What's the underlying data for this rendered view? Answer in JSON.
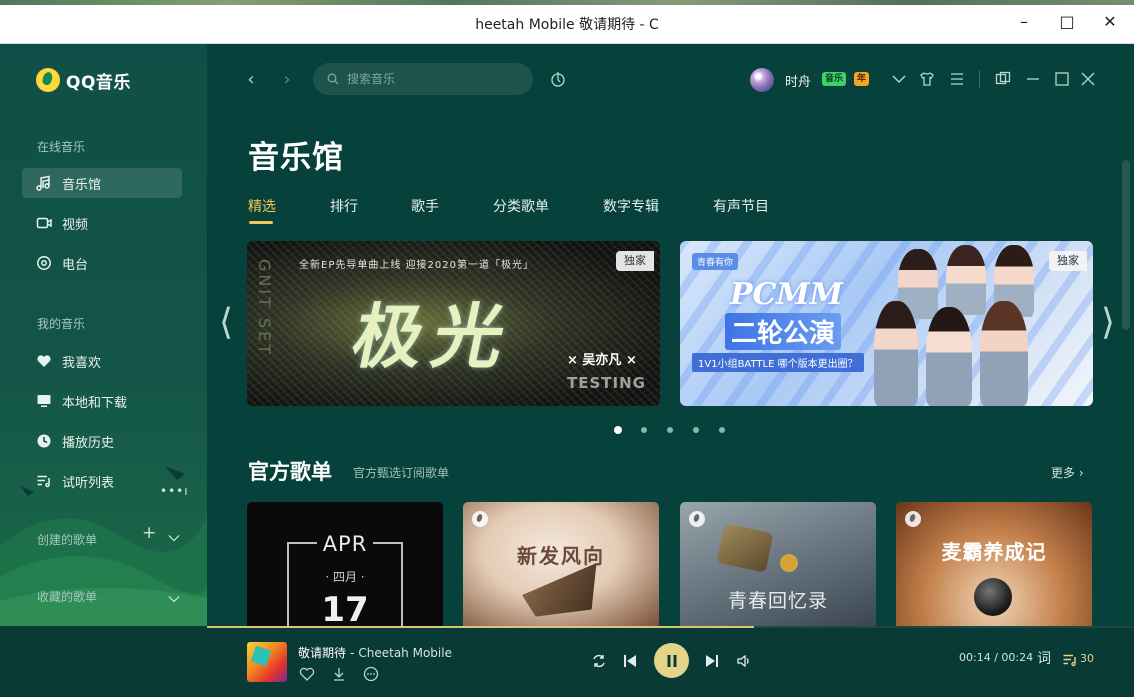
{
  "window": {
    "title": "heetah Mobile 敬请期待 - C",
    "controls": [
      "minimize",
      "maximize",
      "close"
    ]
  },
  "sidebar": {
    "app_name": "QQ音乐",
    "online_label": "在线音乐",
    "online_items": [
      {
        "label": "音乐馆",
        "icon": "music-note-icon",
        "active": true
      },
      {
        "label": "视频",
        "icon": "video-icon",
        "active": false
      },
      {
        "label": "电台",
        "icon": "radio-icon",
        "active": false
      }
    ],
    "mine_label": "我的音乐",
    "mine_items": [
      {
        "label": "我喜欢",
        "icon": "heart-icon"
      },
      {
        "label": "本地和下载",
        "icon": "monitor-icon"
      },
      {
        "label": "播放历史",
        "icon": "clock-icon"
      },
      {
        "label": "试听列表",
        "icon": "playlist-icon"
      }
    ],
    "created_label": "创建的歌单",
    "collected_label": "收藏的歌单"
  },
  "topbar": {
    "search_placeholder": "搜索音乐",
    "username": "时舟",
    "badge_green": "音乐",
    "badge_orange": "年"
  },
  "main": {
    "page_title": "音乐馆",
    "tabs": [
      "精选",
      "排行",
      "歌手",
      "分类歌单",
      "数字专辑",
      "有声节目"
    ],
    "active_tab": 0,
    "banners": [
      {
        "badge": "独家",
        "topline": "全新EP先导单曲上线 迎接2020第一道「极光」",
        "headline": "极光",
        "artist": "× 吴亦凡 ×",
        "footer": "TESTING"
      },
      {
        "badge": "独家",
        "brand": "青春有你",
        "headline": "PCMM",
        "round": "二轮公演",
        "sub": "1V1小组BATTLE 哪个版本更出圈？"
      }
    ],
    "carousel_pages": 5,
    "carousel_active": 0,
    "section_title": "官方歌单",
    "section_subtitle": "官方甄选订阅歌单",
    "more_label": "更多",
    "playlists": [
      {
        "month": "APR",
        "month_cn": "· 四月 ·",
        "day": "17"
      },
      {
        "title": "新发风向"
      },
      {
        "title": "青春回忆录"
      },
      {
        "title": "麦霸养成记"
      }
    ]
  },
  "player": {
    "song_title": "敬请期待",
    "separator": "-",
    "artist": "Cheetah Mobile",
    "current_time": "00:14",
    "total_time": "00:24",
    "time_display": "00:14 / 00:24",
    "lyrics_label": "词",
    "playlist_count": "30",
    "progress_fraction": 0.59
  },
  "colors": {
    "sidebar_bg": "#0f4f47",
    "main_bg": "#07413c",
    "accent": "#f0c857",
    "pause_button": "#e4d48a"
  }
}
